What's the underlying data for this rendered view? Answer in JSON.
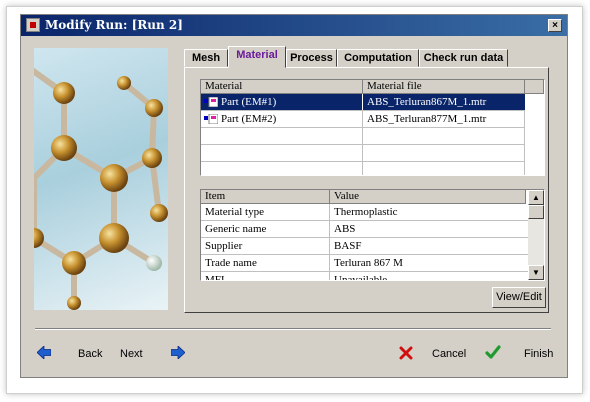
{
  "window": {
    "title": "Modify Run: [Run 2]",
    "close_label": "×"
  },
  "tabs": [
    {
      "label": "Mesh"
    },
    {
      "label": "Material"
    },
    {
      "label": "Process"
    },
    {
      "label": "Computation"
    },
    {
      "label": "Check run data"
    }
  ],
  "active_tab": "Material",
  "material_grid": {
    "headers": [
      "Material",
      "Material file"
    ],
    "rows": [
      {
        "material": "Part (EM#1)",
        "file": "ABS_Terluran867M_1.mtr",
        "selected": true
      },
      {
        "material": "Part (EM#2)",
        "file": "ABS_Terluran877M_1.mtr",
        "selected": false
      }
    ]
  },
  "properties_grid": {
    "headers": [
      "Item",
      "Value"
    ],
    "rows": [
      {
        "item": "Material type",
        "value": "Thermoplastic"
      },
      {
        "item": "Generic name",
        "value": "ABS"
      },
      {
        "item": "Supplier",
        "value": "BASF"
      },
      {
        "item": "Trade name",
        "value": "Terluran 867 M"
      },
      {
        "item": "MFI",
        "value": "Unavailable"
      }
    ]
  },
  "buttons": {
    "view_edit": "View/Edit"
  },
  "nav": {
    "back": "Back",
    "next": "Next",
    "cancel": "Cancel",
    "finish": "Finish"
  },
  "colors": {
    "title_bar": "#0a246a",
    "selection": "#0a246a",
    "active_tab_text": "#6a1b9a",
    "dialog_bg": "#d4d0c8"
  },
  "icons": [
    "back-arrow-icon",
    "next-arrow-icon",
    "cancel-x-icon",
    "finish-check-icon",
    "molecule-illustration"
  ]
}
